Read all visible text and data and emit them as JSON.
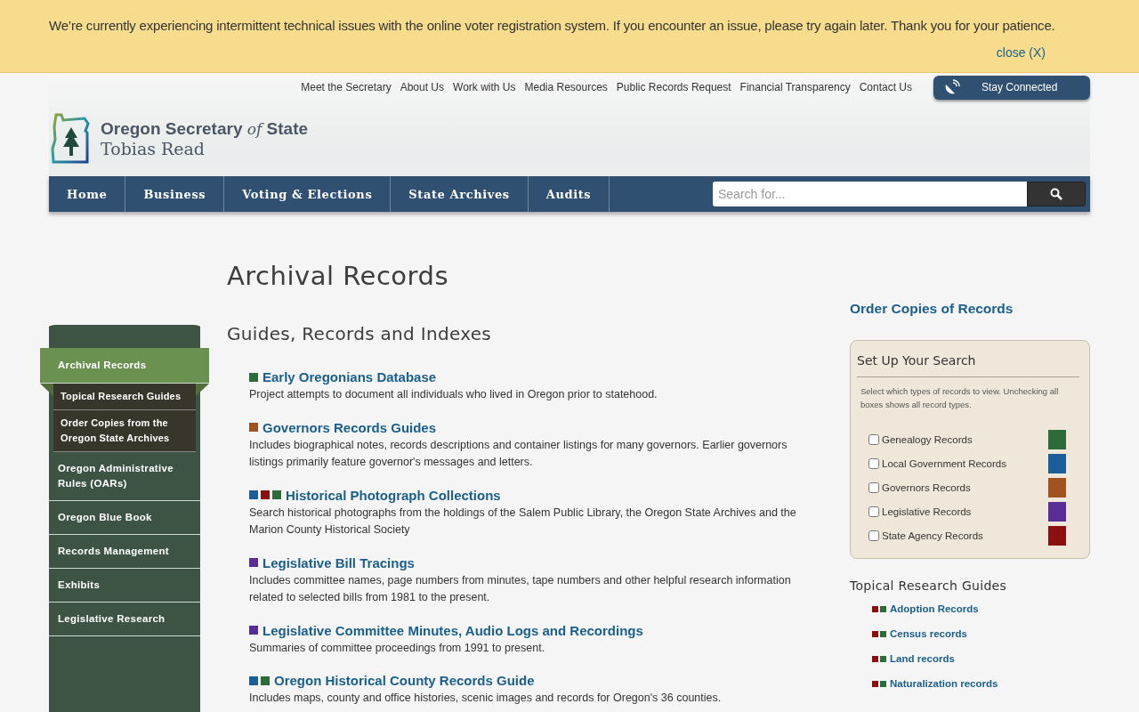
{
  "banner": {
    "message": "We’re currently experiencing intermittent technical issues with the online voter registration system. If you encounter an issue, please try again later. Thank you for your patience.",
    "close": "close (X)"
  },
  "utility_links": [
    "Meet the Secretary",
    "About Us",
    "Work with Us",
    "Media Resources",
    "Public Records Request",
    "Financial Transparency",
    "Contact Us"
  ],
  "stay_connected": "Stay Connected",
  "logo": {
    "title": "Oregon Secretary *of* State",
    "subtitle": "Tobias Read"
  },
  "nav": [
    "Home",
    "Business",
    "Voting & Elections",
    "State Archives",
    "Audits"
  ],
  "search": {
    "placeholder": "Search for..."
  },
  "sidebar": [
    {
      "label": "Archival Records",
      "selected": true,
      "children": [
        {
          "label": "Topical Research Guides"
        },
        {
          "label": "Order Copies from the Oregon State Archives"
        }
      ]
    },
    {
      "label": "Oregon Administrative Rules (OARs)",
      "selected": false
    },
    {
      "label": "Oregon Blue Book",
      "selected": false
    },
    {
      "label": "Records Management",
      "selected": false
    },
    {
      "label": "Exhibits",
      "selected": false
    },
    {
      "label": "Legislative Research",
      "selected": false
    }
  ],
  "page_title": "Archival Records",
  "section_title": "Guides, Records and Indexes",
  "records": [
    {
      "title": "Early Oregonians Database",
      "description": "Project attempts to document all individuals who lived in Oregon prior to statehood.",
      "squares": [
        {
          "color": "#2e6b3a"
        }
      ]
    },
    {
      "title": "Governors Records Guides",
      "description": "Includes biographical notes, records descriptions and container listings for many governors. Earlier governors listings primarily feature governor's messages and letters.",
      "squares": [
        {
          "color": "#a0521f"
        }
      ]
    },
    {
      "title": "Historical Photograph Collections",
      "description": "Search historical photographs from the holdings of the Salem Public Library, the Oregon State Archives and the Marion County Historical Society",
      "squares": [
        {
          "color": "#1a5e99"
        },
        {
          "color": "#8b0f0f"
        },
        {
          "color": "#2e6b3a"
        }
      ]
    },
    {
      "title": "Legislative Bill Tracings",
      "description": "Includes committee names, page numbers from minutes, tape numbers and other helpful research information related to selected bills from 1981 to the present.",
      "squares": [
        {
          "color": "#5a2d96"
        }
      ]
    },
    {
      "title": "Legislative Committee Minutes, Audio Logs and Recordings",
      "description": "Summaries of committee proceedings from 1991 to present.",
      "squares": [
        {
          "color": "#5a2d96"
        }
      ]
    },
    {
      "title": "Oregon Historical County Records Guide",
      "description": "Includes maps, county and office histories, scenic images and records for Oregon's 36 counties.",
      "squares": [
        {
          "color": "#1a5e99"
        },
        {
          "color": "#2e6b3a"
        }
      ]
    }
  ],
  "order_link": "Order Copies of Records",
  "filter": {
    "title": "Set Up Your Search",
    "hint": "Select which types of records to view. Unchecking all boxes shows all record types.",
    "options": [
      {
        "label": "Genealogy Records",
        "checked": false,
        "color": "#2e6b3a"
      },
      {
        "label": "Local Government Records",
        "checked": false,
        "color": "#1a5e99"
      },
      {
        "label": "Governors Records",
        "checked": false,
        "color": "#a0521f"
      },
      {
        "label": "Legislative Records",
        "checked": false,
        "color": "#5a2d96"
      },
      {
        "label": "State Agency Records",
        "checked": false,
        "color": "#8b0f0f"
      }
    ]
  },
  "guides_title": "Topical Research Guides",
  "guides": [
    {
      "label": "Adoption Records",
      "squares": [
        {
          "color": "#8b0f0f"
        },
        {
          "color": "#2e6b3a"
        }
      ]
    },
    {
      "label": "Census records",
      "squares": [
        {
          "color": "#8b0f0f"
        },
        {
          "color": "#2e6b3a"
        }
      ]
    },
    {
      "label": "Land records",
      "squares": [
        {
          "color": "#8b0f0f"
        },
        {
          "color": "#2e6b3a"
        }
      ]
    },
    {
      "label": "Naturalization records",
      "squares": [
        {
          "color": "#8b0f0f"
        },
        {
          "color": "#2e6b3a"
        }
      ]
    }
  ]
}
